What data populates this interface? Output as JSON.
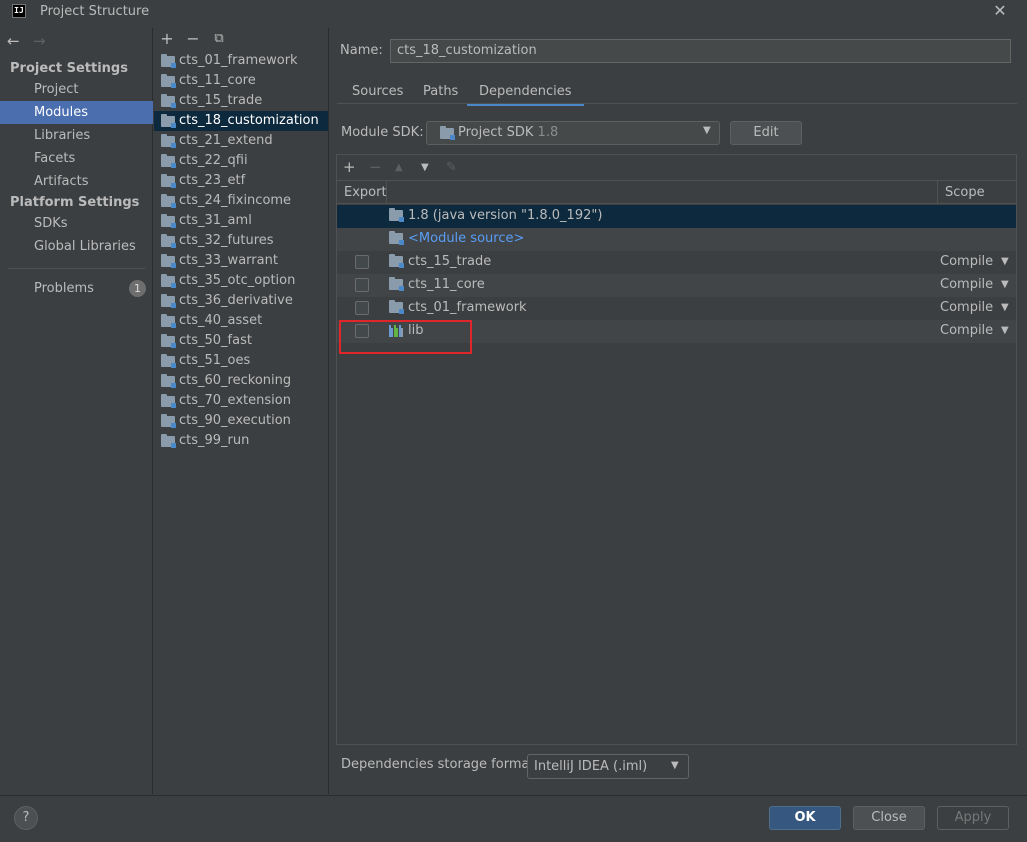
{
  "window": {
    "title": "Project Structure",
    "logo": "IJ",
    "close_glyph": "✕"
  },
  "nav": {
    "back_glyph": "←",
    "forward_glyph": "→",
    "project_settings_heading": "Project Settings",
    "project_settings_items": [
      "Project",
      "Modules",
      "Libraries",
      "Facets",
      "Artifacts"
    ],
    "selected_item": "Modules",
    "platform_settings_heading": "Platform Settings",
    "platform_settings_items": [
      "SDKs",
      "Global Libraries"
    ],
    "problems_label": "Problems",
    "problems_count": "1"
  },
  "module_toolbar": {
    "add_glyph": "+",
    "remove_glyph": "−",
    "copy_glyph": "⧉"
  },
  "modules": [
    "cts_01_framework",
    "cts_11_core",
    "cts_15_trade",
    "cts_18_customization",
    "cts_21_extend",
    "cts_22_qfii",
    "cts_23_etf",
    "cts_24_fixincome",
    "cts_31_aml",
    "cts_32_futures",
    "cts_33_warrant",
    "cts_35_otc_option",
    "cts_36_derivative",
    "cts_40_asset",
    "cts_50_fast",
    "cts_51_oes",
    "cts_60_reckoning",
    "cts_70_extension",
    "cts_90_execution",
    "cts_99_run"
  ],
  "selected_module": "cts_18_customization",
  "details": {
    "name_label": "Name:",
    "name_value": "cts_18_customization",
    "tabs": [
      "Sources",
      "Paths",
      "Dependencies"
    ],
    "active_tab": "Dependencies",
    "module_sdk_label": "Module SDK:",
    "module_sdk_value": "Project SDK",
    "module_sdk_version": "1.8",
    "edit_label": "Edit",
    "dep_toolbar": {
      "add": "+",
      "remove": "−",
      "up": "▲",
      "down": "▼",
      "edit": "✎"
    },
    "table_headers": {
      "export": "Export",
      "scope": "Scope"
    },
    "dependencies": [
      {
        "name": "1.8 (java version \"1.8.0_192\")",
        "kind": "sdk",
        "scope": "",
        "checkbox": false
      },
      {
        "name": "<Module source>",
        "kind": "source",
        "scope": "",
        "checkbox": false
      },
      {
        "name": "cts_15_trade",
        "kind": "module",
        "scope": "Compile",
        "checkbox": true
      },
      {
        "name": "cts_11_core",
        "kind": "module",
        "scope": "Compile",
        "checkbox": true
      },
      {
        "name": "cts_01_framework",
        "kind": "module",
        "scope": "Compile",
        "checkbox": true
      },
      {
        "name": "lib",
        "kind": "library",
        "scope": "Compile",
        "checkbox": true
      }
    ],
    "storage_format_label": "Dependencies storage format:",
    "storage_format_value": "IntelliJ IDEA (.iml)"
  },
  "footer": {
    "help_glyph": "?",
    "ok_label": "OK",
    "cancel_label": "Close",
    "apply_label": "Apply"
  },
  "colors": {
    "selection": "#4b6eaf",
    "tree_selection": "#0d293e",
    "highlight_box": "#e0262a",
    "link": "#589df6"
  }
}
